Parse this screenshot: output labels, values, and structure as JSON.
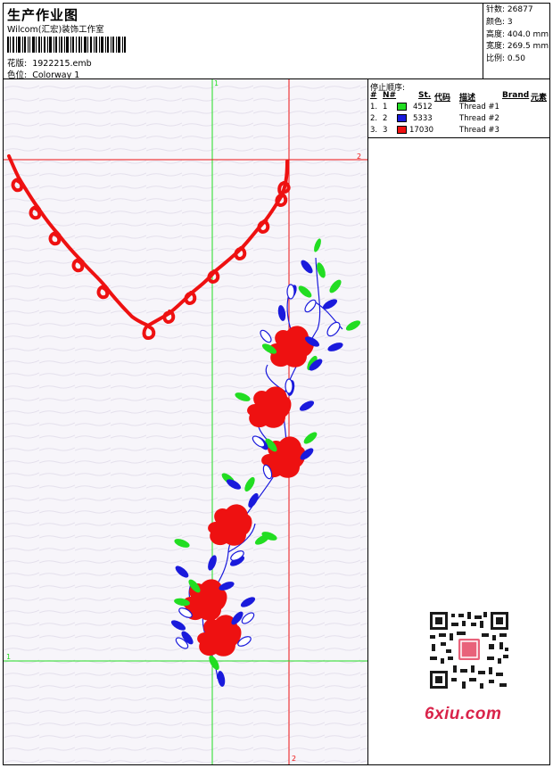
{
  "header": {
    "title": "生产作业图",
    "company": "Wilcom(汇宏)装饰工作室",
    "design_label": "花版:",
    "design_value": "1922215.emb",
    "colorway_label": "色位:",
    "colorway_value": "Colorway 1"
  },
  "stats": [
    {
      "label": "针数:",
      "value": "26877"
    },
    {
      "label": "颜色:",
      "value": "3"
    },
    {
      "label": "高度:",
      "value": "404.0 mm"
    },
    {
      "label": "宽度:",
      "value": "269.5 mm"
    },
    {
      "label": "比例:",
      "value": "0.50"
    }
  ],
  "stop_sequence": {
    "heading": "停止顺序:",
    "columns": [
      "#",
      "N#",
      "St.",
      "代码",
      "描述",
      "Brand",
      "元素"
    ],
    "rows": [
      {
        "index": "1.",
        "n": "1",
        "color": "#22dd22",
        "code": "4512",
        "desc": "Thread #1"
      },
      {
        "index": "2.",
        "n": "2",
        "color": "#1a1adc",
        "code": "5333",
        "desc": "Thread #2"
      },
      {
        "index": "3.",
        "n": "3",
        "color": "#ee1111",
        "code": "17030",
        "desc": "Thread #3"
      }
    ]
  },
  "guides": {
    "v_green_top": "1",
    "h_red_right": "2",
    "h_green_left": "1",
    "v_red_bottom": "2"
  },
  "colors": {
    "guide_green": "#22dd22",
    "guide_red": "#ee1111",
    "leaf_green": "#22dd22",
    "leaf_blue": "#1a1adc",
    "flower_red": "#ee1111"
  },
  "watermark": {
    "site": "6xiu.com"
  }
}
